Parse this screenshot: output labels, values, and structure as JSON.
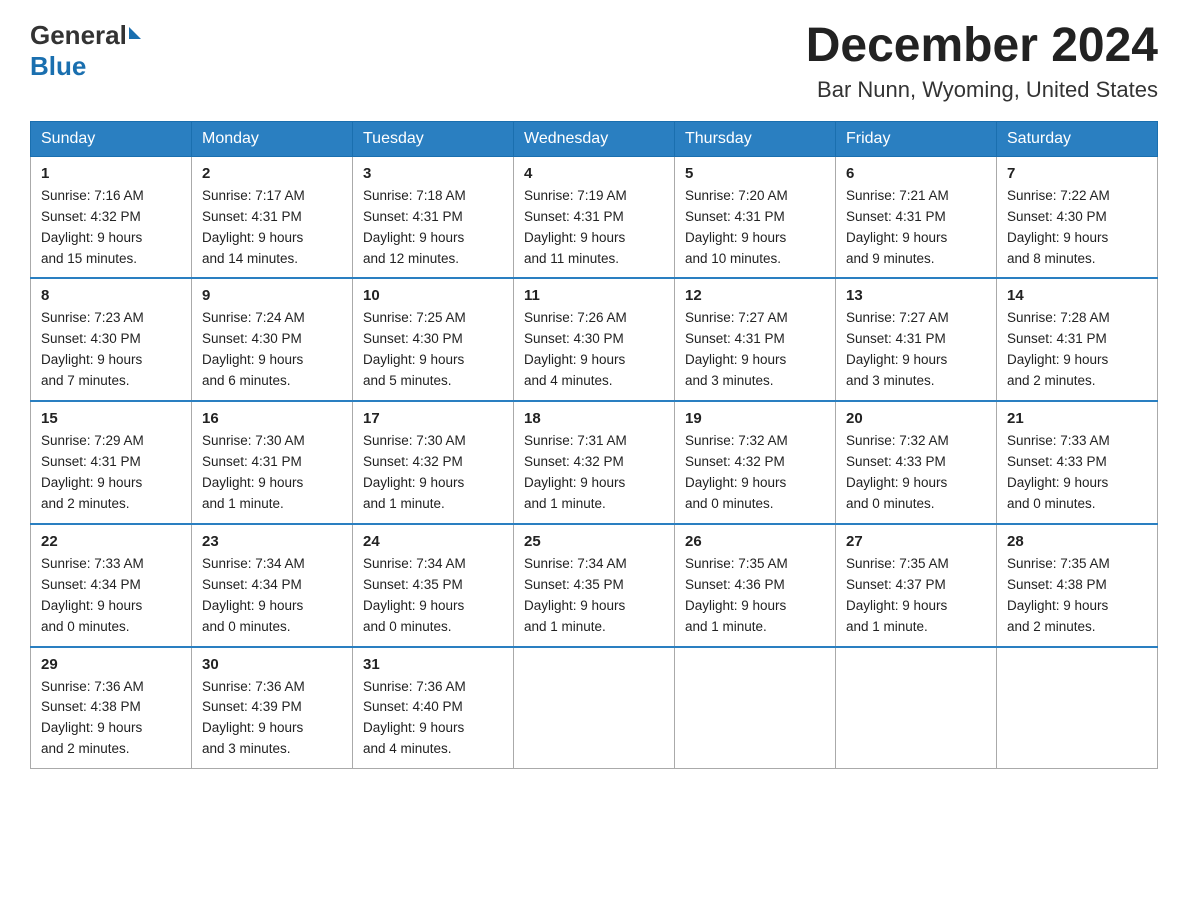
{
  "header": {
    "logo_general": "General",
    "logo_blue": "Blue",
    "month_title": "December 2024",
    "location": "Bar Nunn, Wyoming, United States"
  },
  "weekdays": [
    "Sunday",
    "Monday",
    "Tuesday",
    "Wednesday",
    "Thursday",
    "Friday",
    "Saturday"
  ],
  "weeks": [
    [
      {
        "day": "1",
        "sunrise": "7:16 AM",
        "sunset": "4:32 PM",
        "daylight": "9 hours and 15 minutes."
      },
      {
        "day": "2",
        "sunrise": "7:17 AM",
        "sunset": "4:31 PM",
        "daylight": "9 hours and 14 minutes."
      },
      {
        "day": "3",
        "sunrise": "7:18 AM",
        "sunset": "4:31 PM",
        "daylight": "9 hours and 12 minutes."
      },
      {
        "day": "4",
        "sunrise": "7:19 AM",
        "sunset": "4:31 PM",
        "daylight": "9 hours and 11 minutes."
      },
      {
        "day": "5",
        "sunrise": "7:20 AM",
        "sunset": "4:31 PM",
        "daylight": "9 hours and 10 minutes."
      },
      {
        "day": "6",
        "sunrise": "7:21 AM",
        "sunset": "4:31 PM",
        "daylight": "9 hours and 9 minutes."
      },
      {
        "day": "7",
        "sunrise": "7:22 AM",
        "sunset": "4:30 PM",
        "daylight": "9 hours and 8 minutes."
      }
    ],
    [
      {
        "day": "8",
        "sunrise": "7:23 AM",
        "sunset": "4:30 PM",
        "daylight": "9 hours and 7 minutes."
      },
      {
        "day": "9",
        "sunrise": "7:24 AM",
        "sunset": "4:30 PM",
        "daylight": "9 hours and 6 minutes."
      },
      {
        "day": "10",
        "sunrise": "7:25 AM",
        "sunset": "4:30 PM",
        "daylight": "9 hours and 5 minutes."
      },
      {
        "day": "11",
        "sunrise": "7:26 AM",
        "sunset": "4:30 PM",
        "daylight": "9 hours and 4 minutes."
      },
      {
        "day": "12",
        "sunrise": "7:27 AM",
        "sunset": "4:31 PM",
        "daylight": "9 hours and 3 minutes."
      },
      {
        "day": "13",
        "sunrise": "7:27 AM",
        "sunset": "4:31 PM",
        "daylight": "9 hours and 3 minutes."
      },
      {
        "day": "14",
        "sunrise": "7:28 AM",
        "sunset": "4:31 PM",
        "daylight": "9 hours and 2 minutes."
      }
    ],
    [
      {
        "day": "15",
        "sunrise": "7:29 AM",
        "sunset": "4:31 PM",
        "daylight": "9 hours and 2 minutes."
      },
      {
        "day": "16",
        "sunrise": "7:30 AM",
        "sunset": "4:31 PM",
        "daylight": "9 hours and 1 minute."
      },
      {
        "day": "17",
        "sunrise": "7:30 AM",
        "sunset": "4:32 PM",
        "daylight": "9 hours and 1 minute."
      },
      {
        "day": "18",
        "sunrise": "7:31 AM",
        "sunset": "4:32 PM",
        "daylight": "9 hours and 1 minute."
      },
      {
        "day": "19",
        "sunrise": "7:32 AM",
        "sunset": "4:32 PM",
        "daylight": "9 hours and 0 minutes."
      },
      {
        "day": "20",
        "sunrise": "7:32 AM",
        "sunset": "4:33 PM",
        "daylight": "9 hours and 0 minutes."
      },
      {
        "day": "21",
        "sunrise": "7:33 AM",
        "sunset": "4:33 PM",
        "daylight": "9 hours and 0 minutes."
      }
    ],
    [
      {
        "day": "22",
        "sunrise": "7:33 AM",
        "sunset": "4:34 PM",
        "daylight": "9 hours and 0 minutes."
      },
      {
        "day": "23",
        "sunrise": "7:34 AM",
        "sunset": "4:34 PM",
        "daylight": "9 hours and 0 minutes."
      },
      {
        "day": "24",
        "sunrise": "7:34 AM",
        "sunset": "4:35 PM",
        "daylight": "9 hours and 0 minutes."
      },
      {
        "day": "25",
        "sunrise": "7:34 AM",
        "sunset": "4:35 PM",
        "daylight": "9 hours and 1 minute."
      },
      {
        "day": "26",
        "sunrise": "7:35 AM",
        "sunset": "4:36 PM",
        "daylight": "9 hours and 1 minute."
      },
      {
        "day": "27",
        "sunrise": "7:35 AM",
        "sunset": "4:37 PM",
        "daylight": "9 hours and 1 minute."
      },
      {
        "day": "28",
        "sunrise": "7:35 AM",
        "sunset": "4:38 PM",
        "daylight": "9 hours and 2 minutes."
      }
    ],
    [
      {
        "day": "29",
        "sunrise": "7:36 AM",
        "sunset": "4:38 PM",
        "daylight": "9 hours and 2 minutes."
      },
      {
        "day": "30",
        "sunrise": "7:36 AM",
        "sunset": "4:39 PM",
        "daylight": "9 hours and 3 minutes."
      },
      {
        "day": "31",
        "sunrise": "7:36 AM",
        "sunset": "4:40 PM",
        "daylight": "9 hours and 4 minutes."
      },
      null,
      null,
      null,
      null
    ]
  ],
  "labels": {
    "sunrise": "Sunrise:",
    "sunset": "Sunset:",
    "daylight": "Daylight:"
  }
}
